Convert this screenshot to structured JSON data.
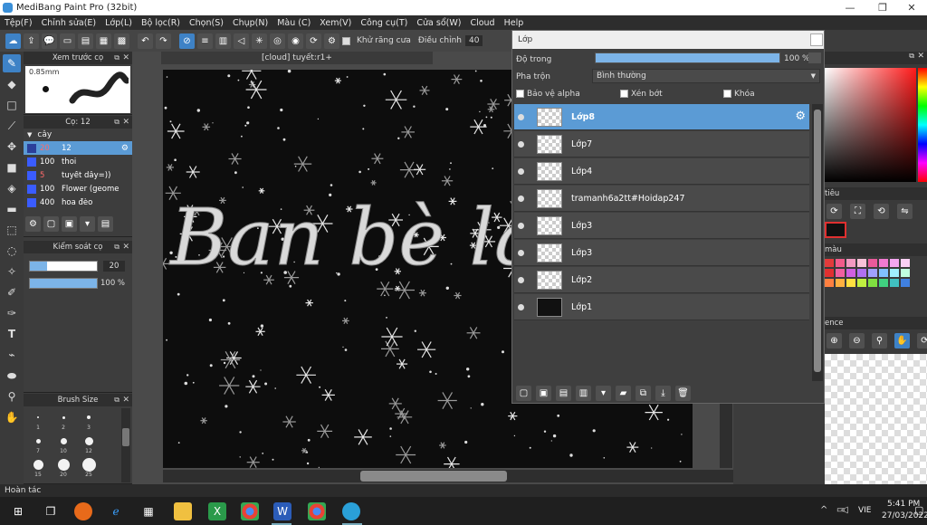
{
  "window": {
    "title": "MediBang Paint Pro (32bit)"
  },
  "menu": [
    "Tệp(F)",
    "Chỉnh sửa(E)",
    "Lớp(L)",
    "Bộ lọc(R)",
    "Chọn(S)",
    "Chụp(N)",
    "Màu (C)",
    "Xem(V)",
    "Công cụ(T)",
    "Cửa sổ(W)",
    "Cloud",
    "Help"
  ],
  "toolbar": {
    "antialias_label": "Khử răng cưa",
    "adjust_label": "Điều chỉnh",
    "adjust_value": "40"
  },
  "brush_preview": {
    "title": "Xem trước cọ",
    "size": "0.85mm"
  },
  "brush_panel": {
    "title": "Cọ: 12",
    "group": "cây",
    "items": [
      {
        "size": "20",
        "name": "12",
        "selected": true
      },
      {
        "size": "100",
        "name": "thoi"
      },
      {
        "size": "5",
        "name": "tuyết dây=))"
      },
      {
        "size": "100",
        "name": "Flower (geome"
      },
      {
        "size": "400",
        "name": "hoa đèo"
      }
    ]
  },
  "brush_control": {
    "title": "Kiểm soát cọ",
    "size_value": "20",
    "opacity_value": "100 %",
    "size_fraction": 0.25,
    "opacity_fraction": 1.0
  },
  "brush_size": {
    "title": "Brush Size",
    "labels": [
      "1",
      "2",
      "3",
      "7",
      "10",
      "12",
      "15",
      "20",
      "25"
    ]
  },
  "document": {
    "tab": "[cloud] tuyết:r1+"
  },
  "layers": {
    "title": "Lớp",
    "opacity_label": "Độ trong",
    "opacity_value": "100 %",
    "blend_label": "Pha trộn",
    "blend_value": "Bình thường",
    "protect_alpha": "Bảo vệ alpha",
    "clipping": "Xén bớt",
    "lock": "Khóa",
    "items": [
      {
        "name": "Lớp8",
        "selected": true,
        "thumb": "transparent"
      },
      {
        "name": "Lớp7",
        "thumb": "transparent"
      },
      {
        "name": "Lớp4",
        "thumb": "transparent"
      },
      {
        "name": "tramanh6a2tt#Hoidap247",
        "thumb": "transparent"
      },
      {
        "name": "Lớp3",
        "thumb": "transparent"
      },
      {
        "name": "Lớp3",
        "thumb": "transparent"
      },
      {
        "name": "Lớp2",
        "thumb": "transparent"
      },
      {
        "name": "Lớp1",
        "thumb": "black"
      }
    ]
  },
  "right_panels": {
    "tieu": "tiêu",
    "mau": "màu",
    "ence": "ence"
  },
  "artwork": {
    "text": "Ban bè là jc"
  },
  "status": {
    "text": "Hoàn tác"
  },
  "taskbar": {
    "lang": "VIE",
    "time": "5:41 PM",
    "date": "27/03/2022"
  },
  "colors": {
    "accent": "#3e82c6",
    "selected_layer": "#5b9bd5",
    "red": "#e03030"
  }
}
